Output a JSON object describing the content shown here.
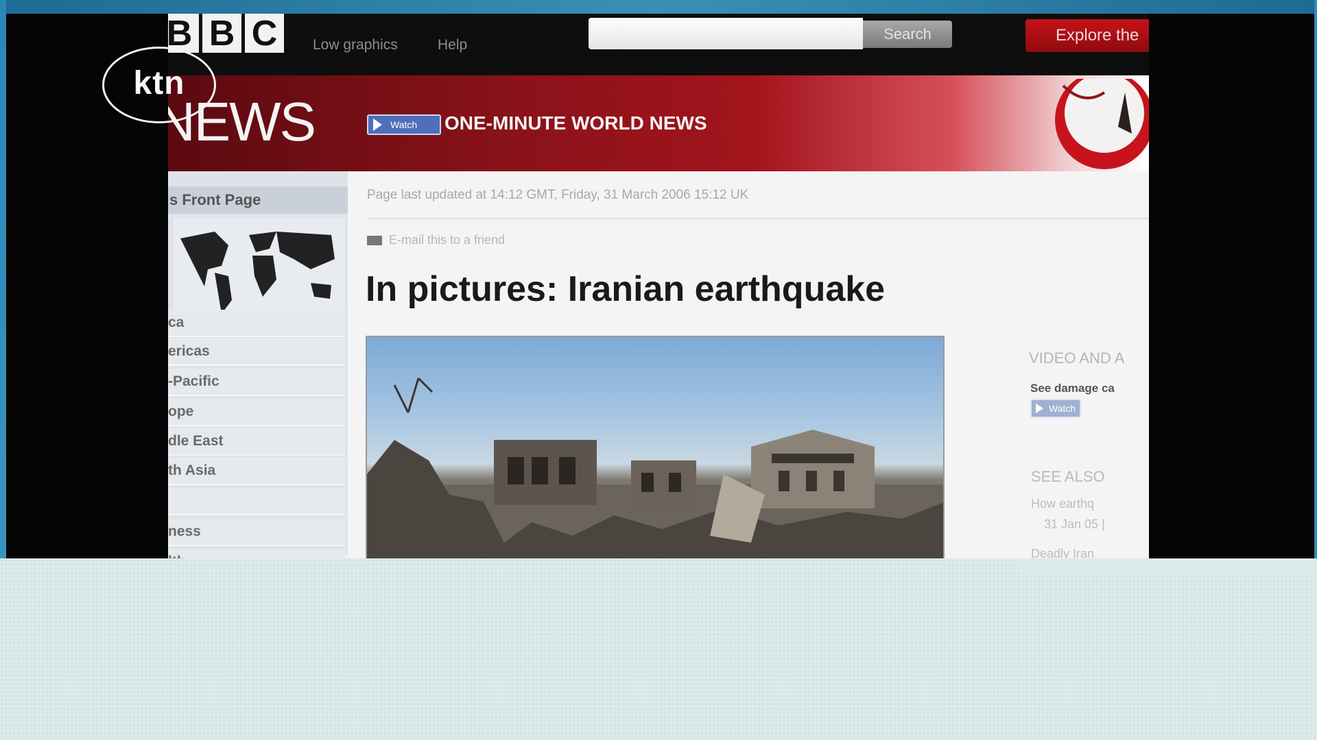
{
  "overlay": {
    "channel_logo": "ktn"
  },
  "browser": {
    "logo_letters": [
      "B",
      "B",
      "C"
    ],
    "links": [
      "Low graphics",
      "Help"
    ],
    "search": {
      "value": "",
      "button_label": "Search"
    },
    "explore_label": "Explore the"
  },
  "banner": {
    "section": "NEWS",
    "watch_badge": "Watch",
    "feature": "ONE-MINUTE WORLD NEWS"
  },
  "left_nav": {
    "header": "s Front Page",
    "items": [
      "ca",
      "ericas",
      "-Pacific",
      "ope",
      "dle East",
      "th Asia",
      "",
      "ness",
      "lth"
    ]
  },
  "article": {
    "updated": "Page last updated at 14:12 GMT, Friday, 31 March 2006 15:12 UK",
    "email_link": "E-mail this to a friend",
    "headline": "In pictures: Iranian earthquake"
  },
  "right_column": {
    "video_heading": "VIDEO AND A",
    "video_item": "See damage ca",
    "watch_label": "Watch",
    "see_also_heading": "SEE ALSO",
    "see_also_items": [
      "How earthq",
      "31 Jan 05 |",
      "Deadly Iran"
    ]
  },
  "colors": {
    "bbc_red": "#a3141c",
    "ktn_frame": "#2a87b4"
  }
}
